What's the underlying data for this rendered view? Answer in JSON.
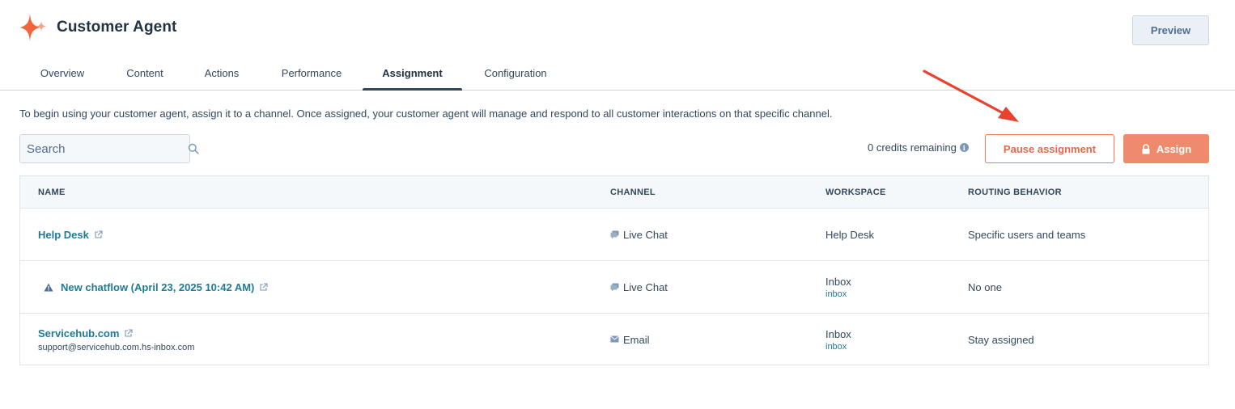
{
  "app": {
    "title": "Customer Agent"
  },
  "header": {
    "preview_label": "Preview"
  },
  "tabs": [
    {
      "label": "Overview"
    },
    {
      "label": "Content"
    },
    {
      "label": "Actions"
    },
    {
      "label": "Performance"
    },
    {
      "label": "Assignment",
      "active": true
    },
    {
      "label": "Configuration"
    }
  ],
  "intro_text": "To begin using your customer agent, assign it to a channel. Once assigned, your customer agent will manage and respond to all customer interactions on that specific channel.",
  "search": {
    "placeholder": "Search",
    "value": ""
  },
  "credits_text": "0 credits remaining",
  "buttons": {
    "pause": "Pause assignment",
    "assign": "Assign"
  },
  "table": {
    "headers": [
      "NAME",
      "CHANNEL",
      "WORKSPACE",
      "ROUTING BEHAVIOR"
    ],
    "rows": [
      {
        "name": "Help Desk",
        "subtext": "",
        "warning": false,
        "channel": "Live Chat",
        "channel_icon": "chat-icon",
        "workspace": "Help Desk",
        "workspace_sub": "",
        "routing": "Specific users and teams"
      },
      {
        "name": "New chatflow (April 23, 2025 10:42 AM)",
        "subtext": "",
        "warning": true,
        "channel": "Live Chat",
        "channel_icon": "chat-icon",
        "workspace": "Inbox",
        "workspace_sub": "inbox",
        "routing": "No one"
      },
      {
        "name": "Servicehub.com",
        "subtext": "support@servicehub.com.hs-inbox.com",
        "warning": false,
        "channel": "Email",
        "channel_icon": "email-icon",
        "workspace": "Inbox",
        "workspace_sub": "inbox",
        "routing": "Stay assigned"
      }
    ]
  },
  "colors": {
    "accent": "#ff7a59",
    "link": "#1f7a99",
    "arrow": "#e8432e",
    "text": "#33475b"
  }
}
